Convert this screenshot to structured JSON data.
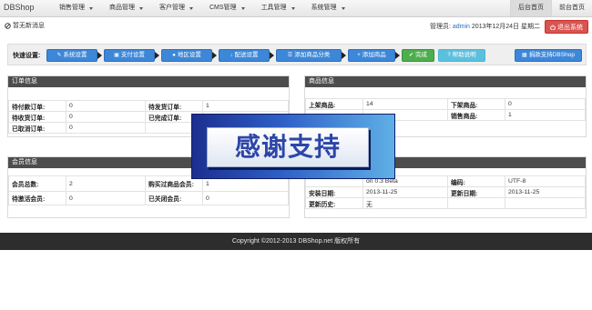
{
  "nav": {
    "brand": "DBShop",
    "menu": [
      {
        "label": "销售管理"
      },
      {
        "label": "商品管理"
      },
      {
        "label": "客户管理"
      },
      {
        "label": "CMS管理"
      },
      {
        "label": "工具管理"
      },
      {
        "label": "系统管理"
      }
    ],
    "right_tabs": [
      {
        "label": "后台首页"
      },
      {
        "label": "前台首页"
      }
    ]
  },
  "header": {
    "message": "暂无新消息",
    "admin_prefix": "管理员:",
    "admin_name": "admin",
    "date": "2013年12月24日 星期二",
    "logout_label": "退出系统"
  },
  "quick": {
    "label": "快速设置:",
    "buttons": [
      {
        "label": "系统设置",
        "icon": "wrench-icon"
      },
      {
        "label": "支付设置",
        "icon": "cart-icon"
      },
      {
        "label": "地区设置",
        "icon": "globe-icon"
      },
      {
        "label": "配送设置",
        "icon": "download-icon"
      },
      {
        "label": "添加商品分类",
        "icon": "list-icon"
      },
      {
        "label": "添加商品",
        "icon": "plus-icon"
      },
      {
        "label": "完成",
        "icon": "check-icon"
      },
      {
        "label": "帮助说明",
        "icon": "help-icon"
      },
      {
        "label": "捐款支持DBShop",
        "icon": "grid-icon"
      }
    ]
  },
  "order_panel": {
    "title": "订单信息",
    "rows": [
      {
        "l1": "待付款订单:",
        "v1": "0",
        "l2": "待发货订单:",
        "v2": "1"
      },
      {
        "l1": "待收货订单:",
        "v1": "0",
        "l2": "已完成订单:",
        "v2": "0"
      },
      {
        "l1": "已取消订单:",
        "v1": "0",
        "l2": "",
        "v2": ""
      }
    ]
  },
  "goods_panel": {
    "title": "商品信息",
    "rows": [
      {
        "l1": "上架商品:",
        "v1": "14",
        "l2": "下架商品:",
        "v2": "0"
      },
      {
        "l1": "",
        "v1": "",
        "l2": "销售商品:",
        "v2": "1"
      }
    ]
  },
  "member_panel": {
    "title": "会员信息",
    "rows": [
      {
        "l1": "会员总数:",
        "v1": "2",
        "l2": "购买过商品会员:",
        "v2": "1"
      },
      {
        "l1": "待激活会员:",
        "v1": "0",
        "l2": "已关闭会员:",
        "v2": "0"
      }
    ]
  },
  "system_panel": {
    "rows": [
      {
        "l1": "",
        "v1": "on 0.3 Beta",
        "l2": "编码:",
        "v2": "UTF-8"
      },
      {
        "l1": "安装日期:",
        "v1": "2013-11-25",
        "l2": "更新日期:",
        "v2": "2013-11-25"
      },
      {
        "l1": "更新历史:",
        "v1": "无",
        "l2": "",
        "v2": ""
      }
    ]
  },
  "banner": {
    "text": "感谢支持"
  },
  "footer": {
    "text": "Copyright ©2012-2013 DBShop.net 版权所有"
  }
}
